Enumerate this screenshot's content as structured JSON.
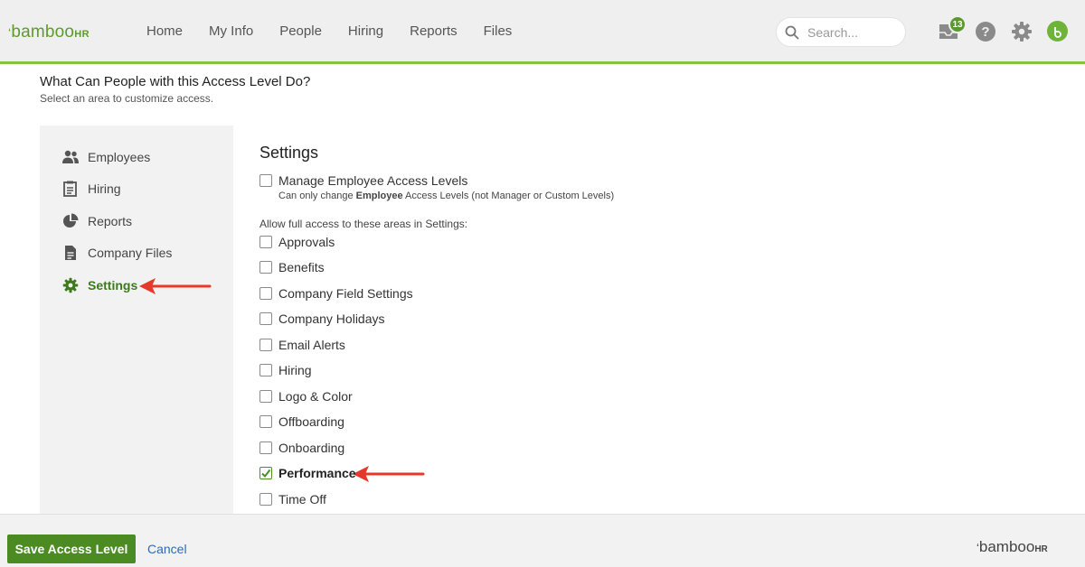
{
  "app": {
    "logo_text": "bamboo",
    "logo_suffix": "HR",
    "nav": [
      "Home",
      "My Info",
      "People",
      "Hiring",
      "Reports",
      "Files"
    ],
    "search_placeholder": "Search...",
    "inbox_count": "13",
    "brand_color": "#5a9a2c"
  },
  "page": {
    "title": "What Can People with this Access Level Do?",
    "subtitle": "Select an area to customize access."
  },
  "sidebar": {
    "items": [
      {
        "label": "Employees",
        "icon": "people-icon"
      },
      {
        "label": "Hiring",
        "icon": "clipboard-icon"
      },
      {
        "label": "Reports",
        "icon": "pie-chart-icon"
      },
      {
        "label": "Company Files",
        "icon": "document-icon"
      },
      {
        "label": "Settings",
        "icon": "gear-icon",
        "active": true
      }
    ]
  },
  "settings": {
    "title": "Settings",
    "manage_label": "Manage Employee Access Levels",
    "manage_note_pre": "Can only change ",
    "manage_note_bold": "Employee",
    "manage_note_post": " Access Levels (not Manager or Custom Levels)",
    "full_access_label": "Allow full access to these areas in Settings:",
    "areas": [
      {
        "label": "Approvals",
        "checked": false
      },
      {
        "label": "Benefits",
        "checked": false
      },
      {
        "label": "Company Field Settings",
        "checked": false
      },
      {
        "label": "Company Holidays",
        "checked": false
      },
      {
        "label": "Email Alerts",
        "checked": false
      },
      {
        "label": "Hiring",
        "checked": false
      },
      {
        "label": "Logo & Color",
        "checked": false
      },
      {
        "label": "Offboarding",
        "checked": false
      },
      {
        "label": "Onboarding",
        "checked": false
      },
      {
        "label": "Performance",
        "checked": true
      },
      {
        "label": "Time Off",
        "checked": false
      }
    ]
  },
  "footer": {
    "save_label": "Save Access Level",
    "cancel_label": "Cancel",
    "logo_text": "bamboo",
    "logo_suffix": "HR"
  }
}
